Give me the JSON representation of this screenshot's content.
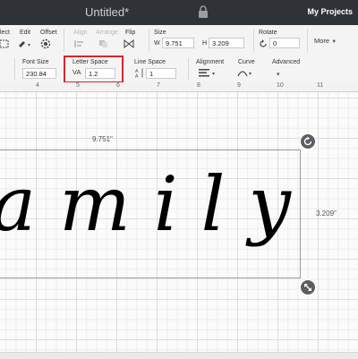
{
  "header": {
    "title": "Untitled*",
    "my_projects": "My Projects"
  },
  "toolbar": {
    "select_label": "lect",
    "edit_label": "Edit",
    "offset_label": "Offset",
    "align_label": "Align",
    "arrange_label": "Arrange",
    "flip_label": "Flip",
    "size_label": "Size",
    "size_w_label": "W",
    "size_w_value": "9.751",
    "size_h_label": "H",
    "size_h_value": "3.209",
    "rotate_label": "Rotate",
    "rotate_value": "0",
    "more_label": "More"
  },
  "text_toolbar": {
    "font_size_label": "Font Size",
    "font_size_value": "230.84",
    "letter_space_label": "Letter Space",
    "letter_space_icon_text": "VA",
    "letter_space_value": "1.2",
    "line_space_label": "Line Space",
    "line_space_value": "1",
    "alignment_label": "Alignment",
    "curve_label": "Curve",
    "advanced_label": "Advanced"
  },
  "ruler": {
    "numbers": [
      "4",
      "5",
      "6",
      "7",
      "8",
      "9",
      "10",
      "11"
    ]
  },
  "canvas": {
    "text": "amily",
    "width_label": "9.751\"",
    "height_label": "3.209\""
  },
  "colors": {
    "titlebar": "#2f3236",
    "highlight": "#d9262c",
    "handle": "#5b5f63"
  },
  "icons": [
    "lock-icon",
    "select-icon",
    "edit-icon",
    "offset-icon",
    "align-icon",
    "arrange-icon",
    "flip-icon",
    "letter-space-icon",
    "line-space-icon",
    "alignment-icon",
    "curve-icon",
    "rotate-icon",
    "scale-icon"
  ]
}
